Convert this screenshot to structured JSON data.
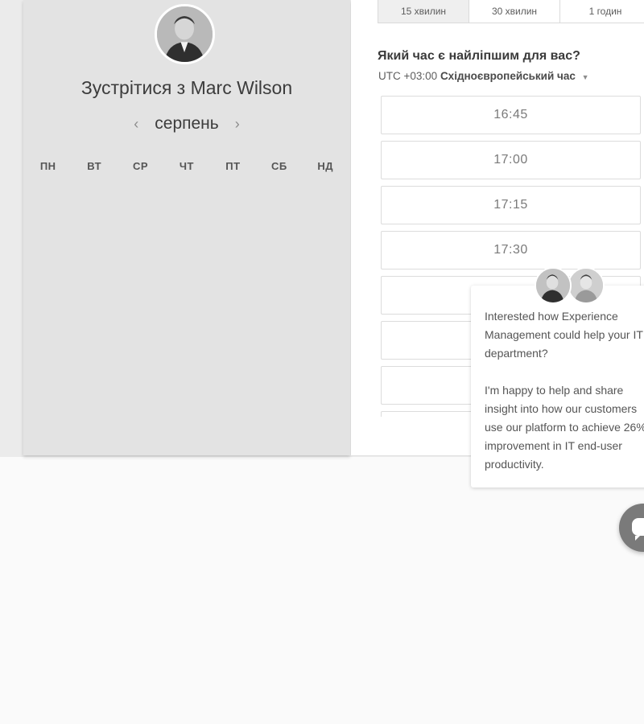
{
  "host": {
    "avatar_icon": "person-portrait-icon",
    "meet_prefix": "Зустрітися з",
    "name": "Marc Wilson"
  },
  "calendar": {
    "prev_icon": "chevron-left-icon",
    "month": "серпень",
    "next_icon": "chevron-right-icon",
    "weekdays": [
      "ПН",
      "ВТ",
      "СР",
      "ЧТ",
      "ПТ",
      "СБ",
      "НД"
    ]
  },
  "duration_tabs": [
    {
      "label": "15 хвилин",
      "active": true
    },
    {
      "label": "30 хвилин",
      "active": false
    },
    {
      "label": "1 годин",
      "active": false
    }
  ],
  "time_question": "Який час є найліпшим для вас?",
  "timezone": {
    "offset": "UTC +03:00",
    "name": "Східноєвропейський час",
    "caret_icon": "caret-down-icon"
  },
  "time_slots": [
    "16:45",
    "17:00",
    "17:15",
    "17:30",
    "",
    "",
    "",
    ""
  ],
  "chat": {
    "avatars": [
      "agent-avatar-icon",
      "agent-avatar-icon"
    ],
    "message_1": "Interested how Experience Management could help your IT department?",
    "message_2": "I'm happy to help and share insight into how our customers use our platform to achieve 26% improvement in IT end-user productivity.",
    "launcher_icon": "chat-bubble-icon"
  },
  "colors": {
    "left_panel_bg": "#e3e3e3",
    "page_bg": "#fafafa",
    "slot_border": "#dcdcdc",
    "launcher": "#7a7a7a"
  }
}
